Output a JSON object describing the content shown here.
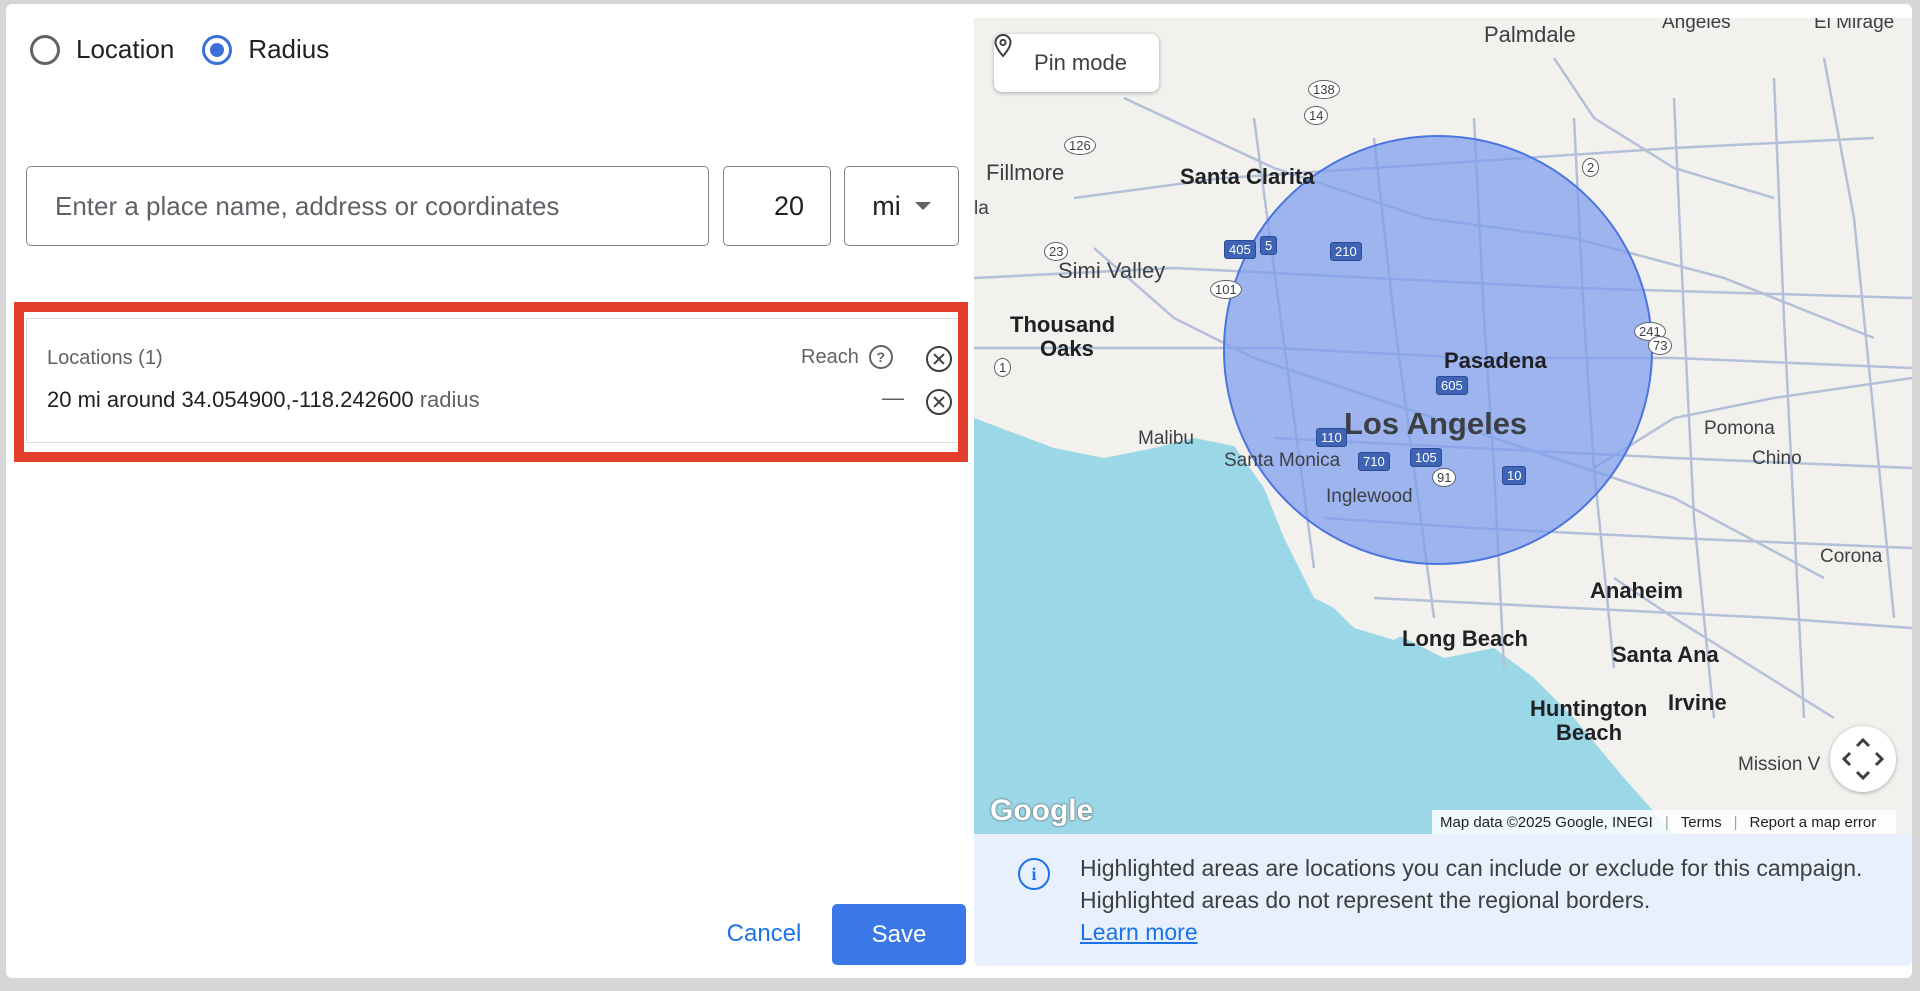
{
  "mode": {
    "options": [
      {
        "label": "Location",
        "selected": false
      },
      {
        "label": "Radius",
        "selected": true
      }
    ]
  },
  "search": {
    "placeholder": "Enter a place name, address or coordinates",
    "value": ""
  },
  "radius": {
    "value": "20",
    "unit": "mi"
  },
  "locations": {
    "header": "Locations (1)",
    "reach_label": "Reach",
    "items": [
      {
        "text": "20 mi around 34.054900,-118.242600",
        "type": "radius",
        "reach": "—"
      }
    ]
  },
  "buttons": {
    "cancel": "Cancel",
    "save": "Save"
  },
  "map": {
    "pin_mode": "Pin mode",
    "labels": {
      "palmdale": "Palmdale",
      "angeles": "Angeles",
      "el_mirage": "El Mirage",
      "fillmore": "Fillmore",
      "santa_clarita": "Santa Clarita",
      "simi_valley": "Simi Valley",
      "thousand_oaks_1": "Thousand",
      "thousand_oaks_2": "Oaks",
      "pasadena": "Pasadena",
      "los_angeles": "Los Angeles",
      "malibu": "Malibu",
      "santa_monica": "Santa Monica",
      "inglewood": "Inglewood",
      "pomona": "Pomona",
      "chino": "Chino",
      "corona": "Corona",
      "anaheim": "Anaheim",
      "long_beach": "Long Beach",
      "santa_ana": "Santa Ana",
      "huntington_beach_1": "Huntington",
      "huntington_beach_2": "Beach",
      "irvine": "Irvine",
      "mission_viejo": "Mission V",
      "la": "la"
    },
    "highways": [
      "138",
      "14",
      "126",
      "2",
      "23",
      "405",
      "5",
      "210",
      "101",
      "1",
      "605",
      "110",
      "105",
      "710",
      "91",
      "10",
      "241",
      "73"
    ],
    "google_logo": "Google",
    "attribution": {
      "data": "Map data ©2025 Google, INEGI",
      "terms": "Terms",
      "report": "Report a map error"
    },
    "radius_fill": "#7b9cf0",
    "water": "#9ad7e7"
  },
  "info": {
    "text": "Highlighted areas are locations you can include or exclude for this campaign. Highlighted areas do not represent the regional borders.",
    "link": "Learn more"
  },
  "colors": {
    "accent": "#1a73e8",
    "annotation": "#e2402d",
    "save_bg": "#3b78e7"
  }
}
